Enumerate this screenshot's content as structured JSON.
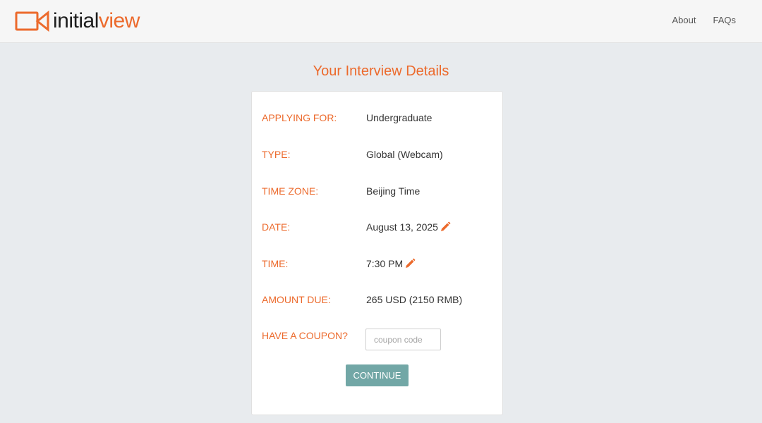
{
  "header": {
    "logo_initial": "initial",
    "logo_view": "view",
    "nav": [
      {
        "label": "About"
      },
      {
        "label": "FAQs"
      }
    ]
  },
  "main": {
    "title": "Your Interview Details",
    "details": [
      {
        "label": "APPLYING FOR:",
        "value": "Undergraduate"
      },
      {
        "label": "TYPE:",
        "value": "Global (Webcam)"
      },
      {
        "label": "TIME ZONE:",
        "value": "Beijing Time"
      },
      {
        "label": "DATE:",
        "value": "August 13, 2025"
      },
      {
        "label": "TIME:",
        "value": "7:30 PM"
      },
      {
        "label": "AMOUNT DUE:",
        "value": "265 USD (2150 RMB)"
      },
      {
        "label": "HAVE A COUPON?"
      }
    ],
    "coupon": {
      "placeholder": "coupon code",
      "value": ""
    },
    "continue_label": "CONTINUE"
  },
  "colors": {
    "accent": "#ec6a2c",
    "button": "#72a7a6",
    "background": "#e8ebee"
  },
  "icons": {
    "edit": "pencil-icon",
    "logo": "camera-icon"
  }
}
